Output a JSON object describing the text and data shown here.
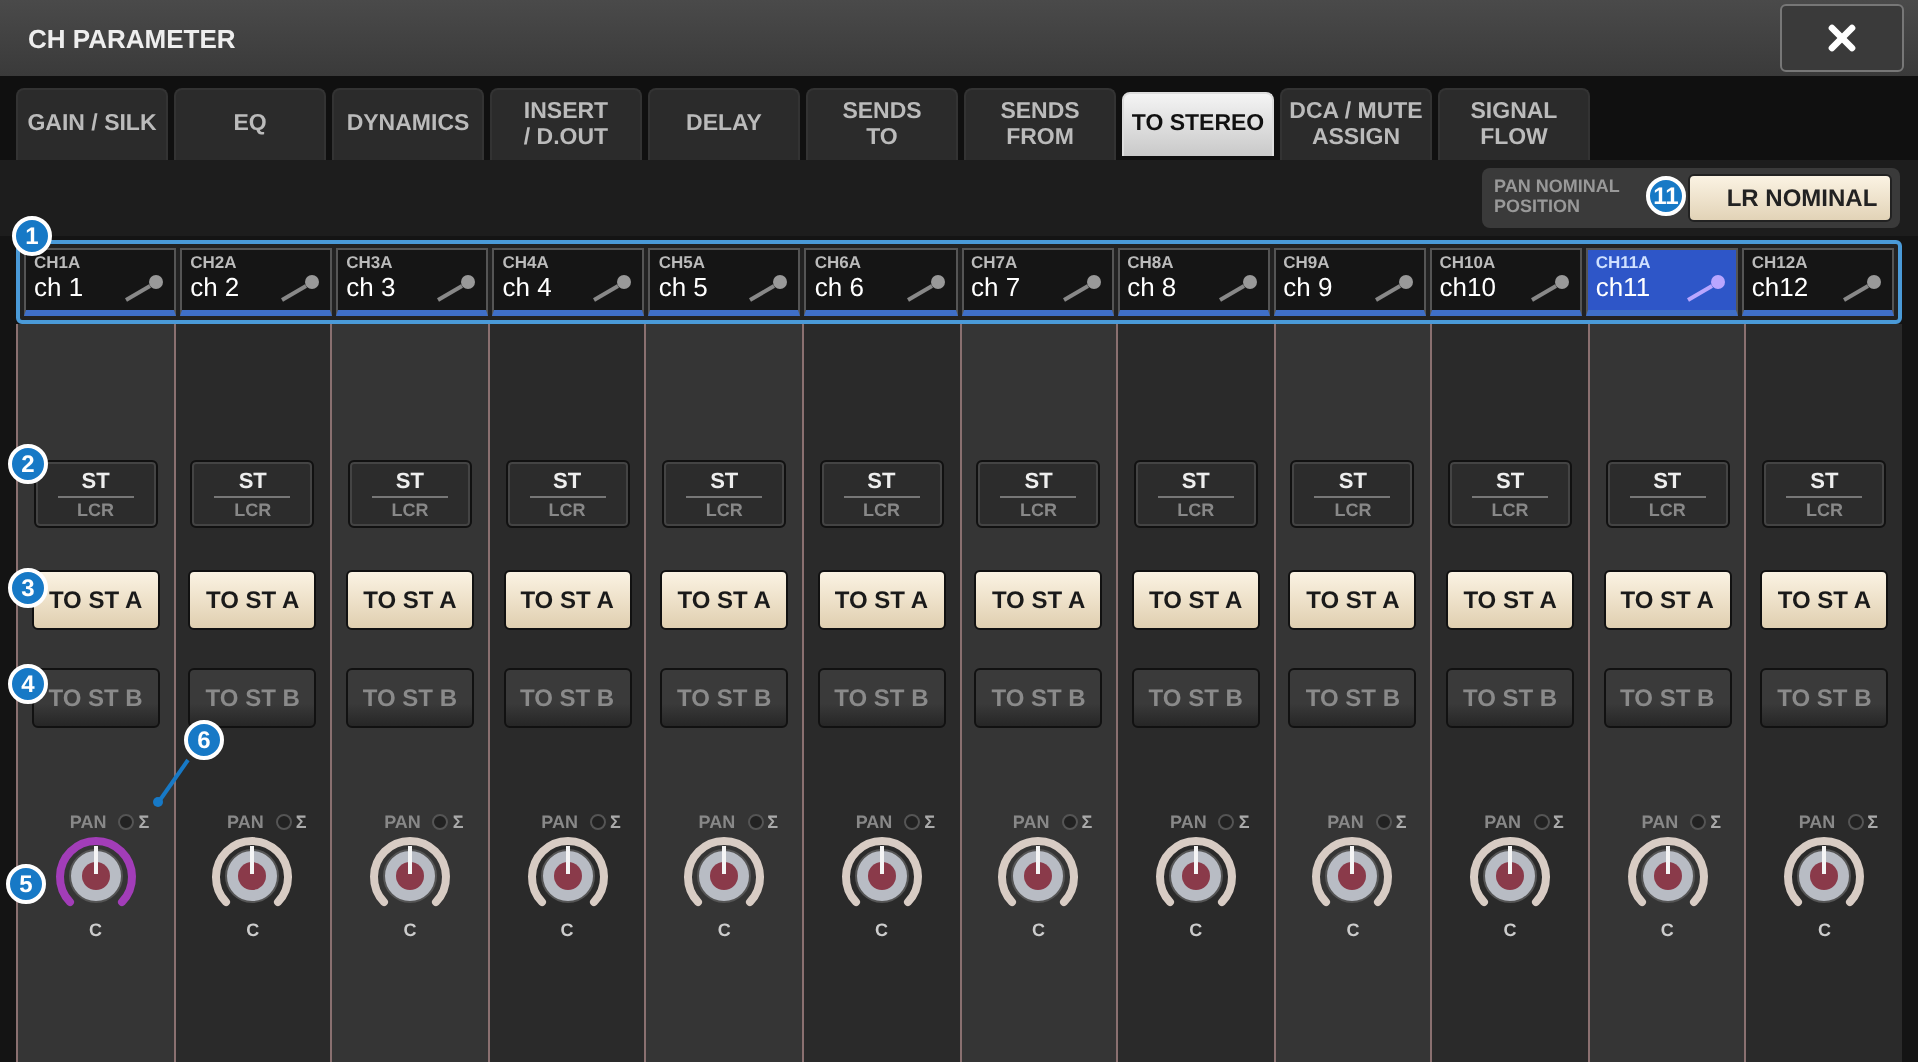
{
  "window": {
    "title": "CH PARAMETER"
  },
  "tabs": [
    {
      "label": "GAIN / SILK",
      "selected": false
    },
    {
      "label": "EQ",
      "selected": false
    },
    {
      "label": "DYNAMICS",
      "selected": false
    },
    {
      "label": "INSERT\n/ D.OUT",
      "selected": false
    },
    {
      "label": "DELAY",
      "selected": false
    },
    {
      "label": "SENDS\nTO",
      "selected": false
    },
    {
      "label": "SENDS\nFROM",
      "selected": false
    },
    {
      "label": "TO STEREO",
      "selected": true
    },
    {
      "label": "DCA / MUTE\nASSIGN",
      "selected": false
    },
    {
      "label": "SIGNAL\nFLOW",
      "selected": false
    }
  ],
  "pan_nominal": {
    "caption": "PAN NOMINAL\nPOSITION",
    "button": "LR NOMINAL"
  },
  "channels": [
    {
      "id": "CH1A",
      "name": "ch 1",
      "selected": false,
      "mode": "ST",
      "mode_sub": "LCR",
      "to_st_a": {
        "label": "TO ST A",
        "on": true
      },
      "to_st_b": {
        "label": "TO ST B",
        "on": false
      },
      "pan": {
        "label": "PAN",
        "sigma": "Σ",
        "value": "C",
        "highlighted": true
      }
    },
    {
      "id": "CH2A",
      "name": "ch 2",
      "selected": false,
      "mode": "ST",
      "mode_sub": "LCR",
      "to_st_a": {
        "label": "TO ST A",
        "on": true
      },
      "to_st_b": {
        "label": "TO ST B",
        "on": false
      },
      "pan": {
        "label": "PAN",
        "sigma": "Σ",
        "value": "C",
        "highlighted": false
      }
    },
    {
      "id": "CH3A",
      "name": "ch 3",
      "selected": false,
      "mode": "ST",
      "mode_sub": "LCR",
      "to_st_a": {
        "label": "TO ST A",
        "on": true
      },
      "to_st_b": {
        "label": "TO ST B",
        "on": false
      },
      "pan": {
        "label": "PAN",
        "sigma": "Σ",
        "value": "C",
        "highlighted": false
      }
    },
    {
      "id": "CH4A",
      "name": "ch 4",
      "selected": false,
      "mode": "ST",
      "mode_sub": "LCR",
      "to_st_a": {
        "label": "TO ST A",
        "on": true
      },
      "to_st_b": {
        "label": "TO ST B",
        "on": false
      },
      "pan": {
        "label": "PAN",
        "sigma": "Σ",
        "value": "C",
        "highlighted": false
      }
    },
    {
      "id": "CH5A",
      "name": "ch 5",
      "selected": false,
      "mode": "ST",
      "mode_sub": "LCR",
      "to_st_a": {
        "label": "TO ST A",
        "on": true
      },
      "to_st_b": {
        "label": "TO ST B",
        "on": false
      },
      "pan": {
        "label": "PAN",
        "sigma": "Σ",
        "value": "C",
        "highlighted": false
      }
    },
    {
      "id": "CH6A",
      "name": "ch 6",
      "selected": false,
      "mode": "ST",
      "mode_sub": "LCR",
      "to_st_a": {
        "label": "TO ST A",
        "on": true
      },
      "to_st_b": {
        "label": "TO ST B",
        "on": false
      },
      "pan": {
        "label": "PAN",
        "sigma": "Σ",
        "value": "C",
        "highlighted": false
      }
    },
    {
      "id": "CH7A",
      "name": "ch 7",
      "selected": false,
      "mode": "ST",
      "mode_sub": "LCR",
      "to_st_a": {
        "label": "TO ST A",
        "on": true
      },
      "to_st_b": {
        "label": "TO ST B",
        "on": false
      },
      "pan": {
        "label": "PAN",
        "sigma": "Σ",
        "value": "C",
        "highlighted": false
      }
    },
    {
      "id": "CH8A",
      "name": "ch 8",
      "selected": false,
      "mode": "ST",
      "mode_sub": "LCR",
      "to_st_a": {
        "label": "TO ST A",
        "on": true
      },
      "to_st_b": {
        "label": "TO ST B",
        "on": false
      },
      "pan": {
        "label": "PAN",
        "sigma": "Σ",
        "value": "C",
        "highlighted": false
      }
    },
    {
      "id": "CH9A",
      "name": "ch 9",
      "selected": false,
      "mode": "ST",
      "mode_sub": "LCR",
      "to_st_a": {
        "label": "TO ST A",
        "on": true
      },
      "to_st_b": {
        "label": "TO ST B",
        "on": false
      },
      "pan": {
        "label": "PAN",
        "sigma": "Σ",
        "value": "C",
        "highlighted": false
      }
    },
    {
      "id": "CH10A",
      "name": "ch10",
      "selected": false,
      "mode": "ST",
      "mode_sub": "LCR",
      "to_st_a": {
        "label": "TO ST A",
        "on": true
      },
      "to_st_b": {
        "label": "TO ST B",
        "on": false
      },
      "pan": {
        "label": "PAN",
        "sigma": "Σ",
        "value": "C",
        "highlighted": false
      }
    },
    {
      "id": "CH11A",
      "name": "ch11",
      "selected": true,
      "mode": "ST",
      "mode_sub": "LCR",
      "to_st_a": {
        "label": "TO ST A",
        "on": true
      },
      "to_st_b": {
        "label": "TO ST B",
        "on": false
      },
      "pan": {
        "label": "PAN",
        "sigma": "Σ",
        "value": "C",
        "highlighted": false
      }
    },
    {
      "id": "CH12A",
      "name": "ch12",
      "selected": false,
      "mode": "ST",
      "mode_sub": "LCR",
      "to_st_a": {
        "label": "TO ST A",
        "on": true
      },
      "to_st_b": {
        "label": "TO ST B",
        "on": false
      },
      "pan": {
        "label": "PAN",
        "sigma": "Σ",
        "value": "C",
        "highlighted": false
      }
    }
  ],
  "callouts": [
    {
      "number": "1",
      "kind": "selector"
    },
    {
      "number": "2",
      "kind": "mode"
    },
    {
      "number": "3",
      "kind": "to_st_a"
    },
    {
      "number": "4",
      "kind": "to_st_b"
    },
    {
      "number": "5",
      "kind": "pan"
    },
    {
      "number": "6",
      "kind": "sigma"
    },
    {
      "number": "11",
      "kind": "nominal"
    }
  ]
}
